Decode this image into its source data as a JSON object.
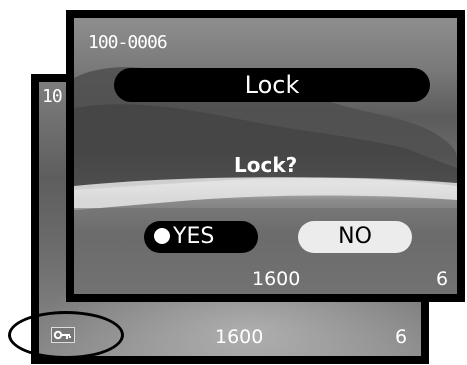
{
  "back_screen": {
    "frame_fragment": "10",
    "iso": "1600",
    "count": "6",
    "lock_icon": "key-icon"
  },
  "front_screen": {
    "frame_number": "100-0006",
    "title": "Lock",
    "prompt": "Lock?",
    "yes_label": "YES",
    "no_label": "NO",
    "selected_option": "YES",
    "iso": "1600",
    "count": "6"
  },
  "colors": {
    "screen_border": "#000000",
    "text": "#ffffff",
    "no_button_bg": "#ececec"
  }
}
